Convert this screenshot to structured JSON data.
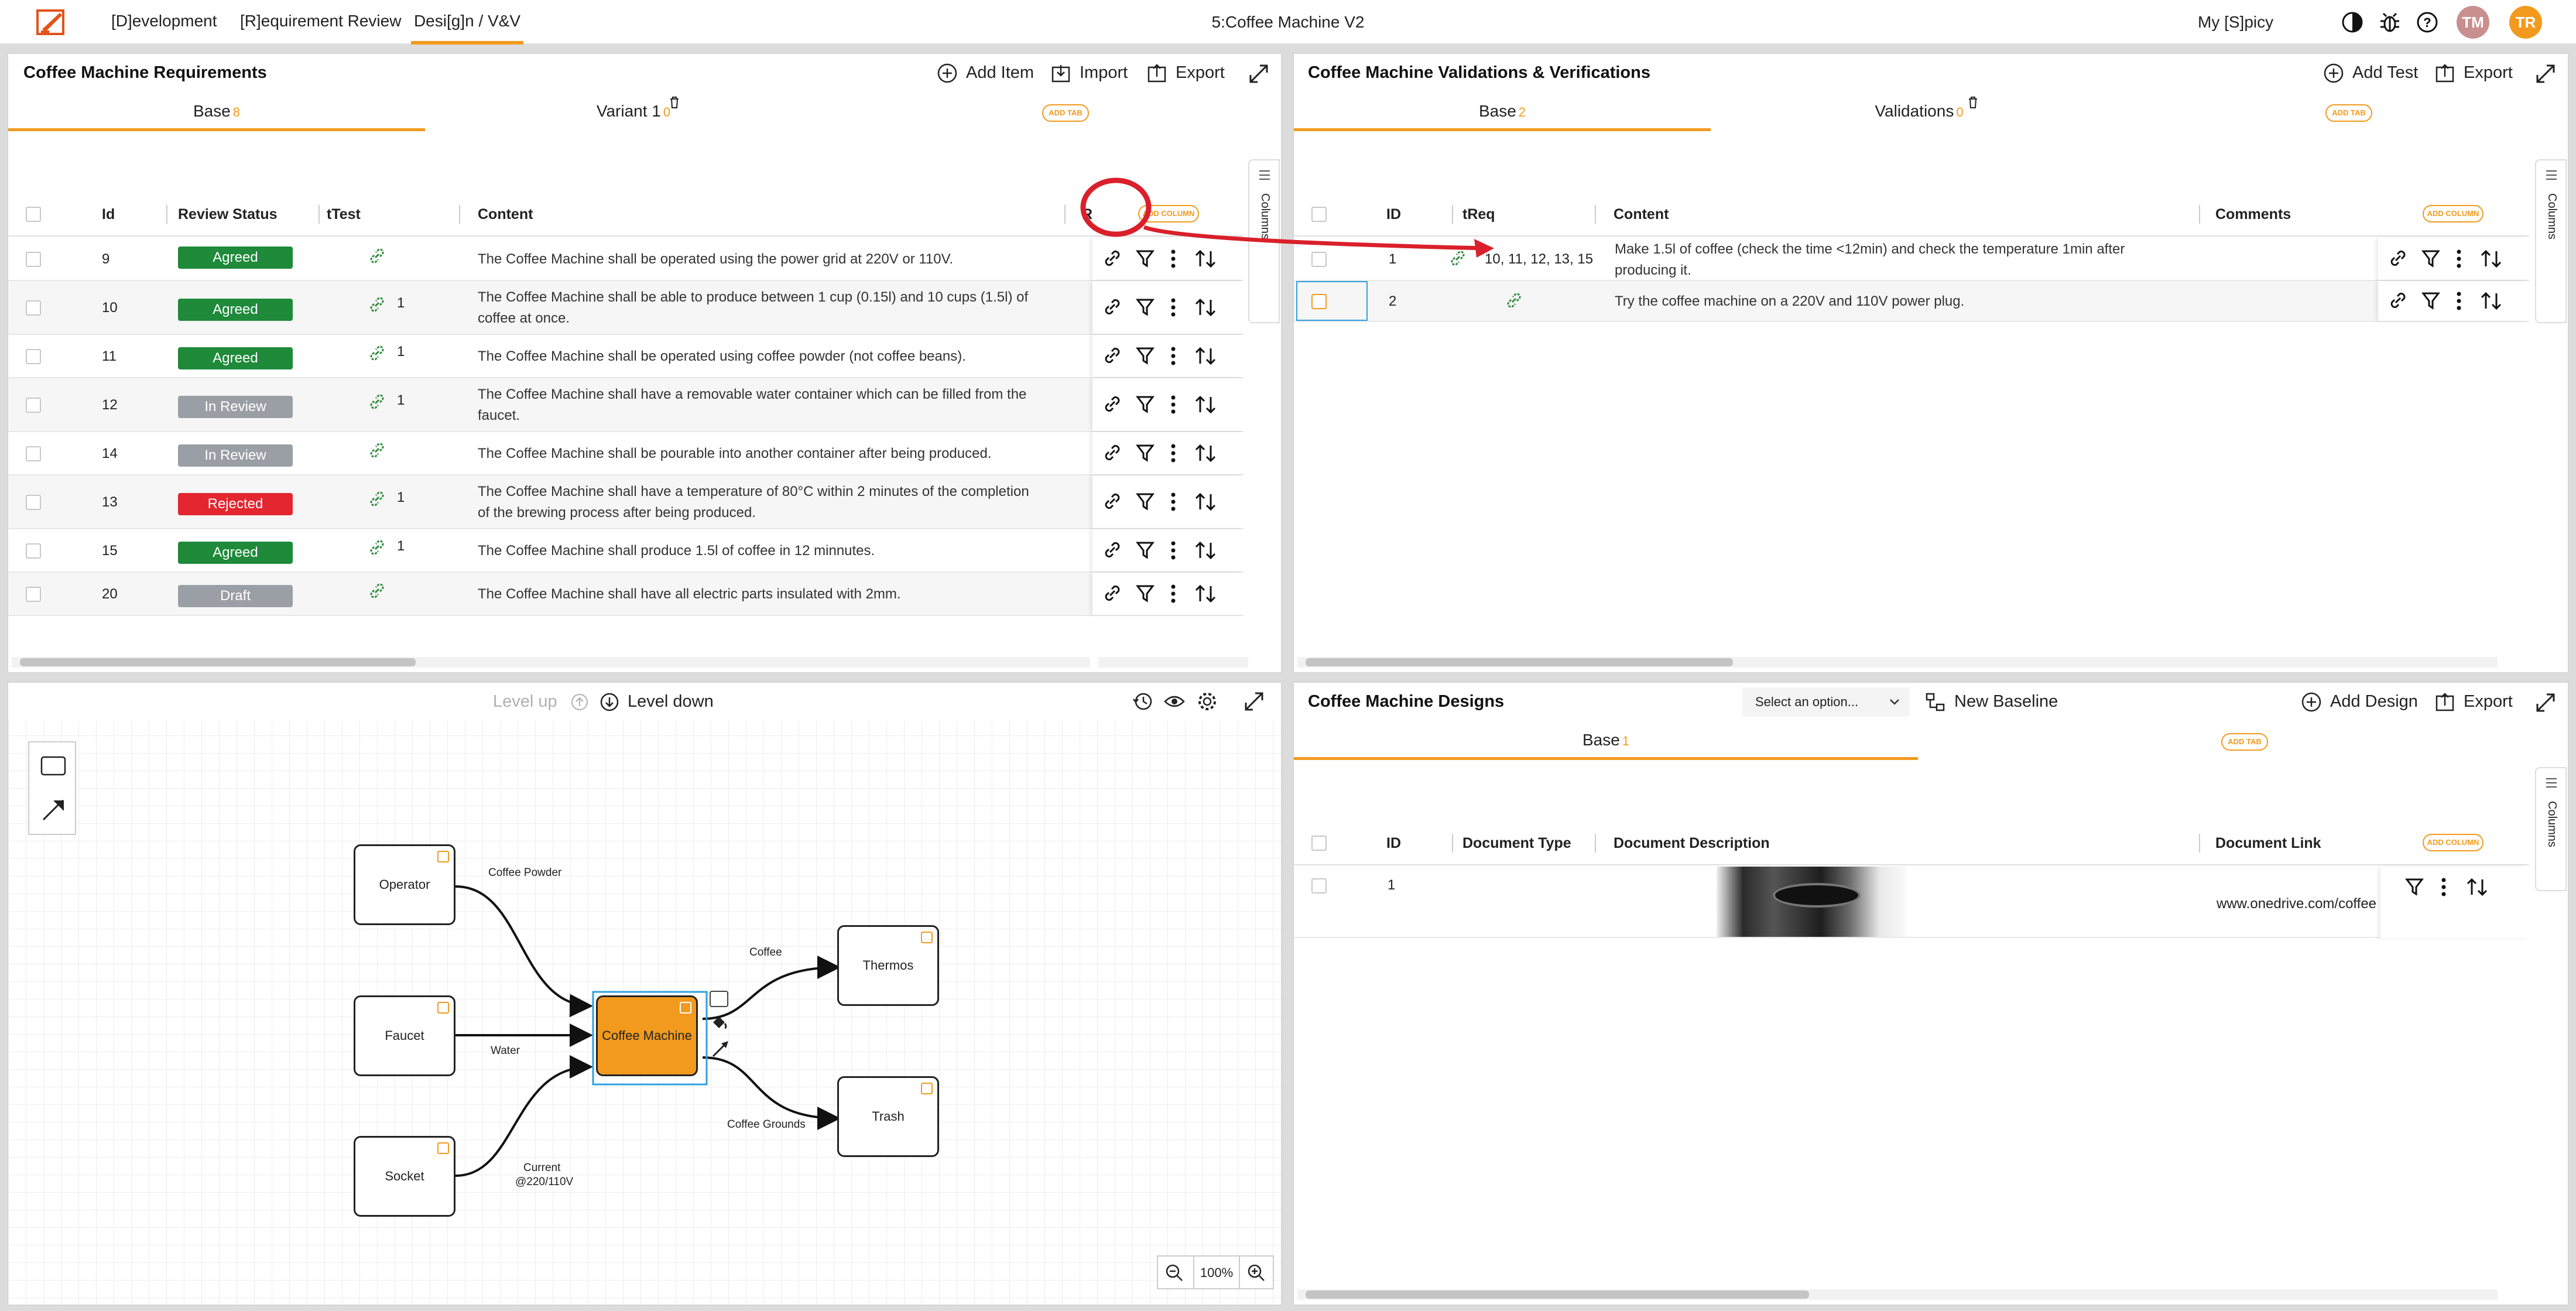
{
  "topbar": {
    "tabs": [
      "[D]evelopment",
      "[R]equirement Review",
      "Desi[g]n / V&V"
    ],
    "active_tab": 2,
    "title": "5:Coffee Machine V2",
    "user_link": "My [S]picy",
    "avatars": [
      {
        "initials": "TM",
        "color": "#c98f8f"
      },
      {
        "initials": "TR",
        "color": "#f29a1e"
      }
    ],
    "icons": [
      "contrast-icon",
      "bug-icon",
      "help-icon"
    ]
  },
  "requirements": {
    "title": "Coffee Machine Requirements",
    "buttons": {
      "add": "Add Item",
      "import": "Import",
      "export": "Export"
    },
    "tabs": [
      {
        "label": "Base",
        "count": "8"
      },
      {
        "label": "Variant 1",
        "count": "0"
      }
    ],
    "add_tab": "ADD TAB",
    "add_column": "ADD COLUMN",
    "columns": [
      "Id",
      "Review Status",
      "tTest",
      "Content",
      "R"
    ],
    "side_tab": "Columns",
    "rows": [
      {
        "id": "9",
        "status": "Agreed",
        "tclass": "b-agreed",
        "ttest": "",
        "content": [
          "The Coffee Machine shall be operated using the power grid at 220V or 110V."
        ]
      },
      {
        "id": "10",
        "status": "Agreed",
        "tclass": "b-agreed",
        "ttest": "1",
        "content": [
          "The Coffee Machine shall be able to produce between 1 cup (0.15l) and 10 cups (1.5l) of",
          "coffee at once."
        ]
      },
      {
        "id": "11",
        "status": "Agreed",
        "tclass": "b-agreed",
        "ttest": "1",
        "content": [
          "The Coffee Machine shall be operated using coffee powder (not coffee beans)."
        ]
      },
      {
        "id": "12",
        "status": "In Review",
        "tclass": "b-review",
        "ttest": "1",
        "content": [
          "The Coffee Machine shall have a removable water container which can be filled from the",
          "faucet."
        ]
      },
      {
        "id": "14",
        "status": "In Review",
        "tclass": "b-review",
        "ttest": "",
        "content": [
          "The Coffee Machine shall be pourable into another container after being produced."
        ]
      },
      {
        "id": "13",
        "status": "Rejected",
        "tclass": "b-rejected",
        "ttest": "1",
        "content": [
          "The Coffee Machine shall have a temperature of 80°C within 2 minutes of the completion",
          "of the brewing process after being produced."
        ]
      },
      {
        "id": "15",
        "status": "Agreed",
        "tclass": "b-agreed",
        "ttest": "1",
        "content": [
          "The Coffee Machine shall produce 1.5l of coffee in 12 minnutes."
        ]
      },
      {
        "id": "20",
        "status": "Draft",
        "tclass": "b-draft",
        "ttest": "",
        "content": [
          "The Coffee Machine shall have all electric parts insulated with 2mm."
        ]
      }
    ]
  },
  "validations": {
    "title": "Coffee Machine Validations & Verifications",
    "buttons": {
      "add": "Add Test",
      "export": "Export"
    },
    "tabs": [
      {
        "label": "Base",
        "count": "2"
      },
      {
        "label": "Validations",
        "count": "0"
      }
    ],
    "add_tab": "ADD TAB",
    "add_column": "ADD COLUMN",
    "columns": [
      "ID",
      "tReq",
      "Content",
      "Comments"
    ],
    "side_tab": "Columns",
    "rows": [
      {
        "id": "1",
        "treq": "10, 11, 12, 13, 15",
        "content": [
          "Make 1.5l of coffee (check the time <12min) and check the temperature 1min after",
          "producing it."
        ]
      },
      {
        "id": "2",
        "treq": "",
        "content": [
          "Try the coffee machine on a 220V and 110V power plug."
        ]
      }
    ]
  },
  "diagram": {
    "level_up": "Level up",
    "level_down": "Level down",
    "zoom": "100%",
    "nodes": {
      "operator": "Operator",
      "faucet": "Faucet",
      "socket": "Socket",
      "machine": "Coffee Machine",
      "thermos": "Thermos",
      "trash": "Trash"
    },
    "edges": {
      "powder": "Coffee Powder",
      "water": "Water",
      "current_1": "Current",
      "current_2": "@220/110V",
      "coffee": "Coffee",
      "grounds": "Coffee Grounds"
    },
    "machine_color": "#f29a1e"
  },
  "designs": {
    "title": "Coffee Machine Designs",
    "select_placeholder": "Select an option...",
    "baseline": "New Baseline",
    "buttons": {
      "add": "Add Design",
      "export": "Export"
    },
    "tabs": [
      {
        "label": "Base",
        "count": "1"
      }
    ],
    "add_tab": "ADD TAB",
    "add_column": "ADD COLUMN",
    "columns": [
      "ID",
      "Document Type",
      "Document Description",
      "Document Link"
    ],
    "side_tab": "Columns",
    "rows": [
      {
        "id": "1",
        "type": "",
        "link": "www.onedrive.com/coffee"
      }
    ]
  },
  "colors": {
    "accent": "#f29a1e",
    "annotation": "#d9202b",
    "link_green": "#2e8b3a"
  }
}
